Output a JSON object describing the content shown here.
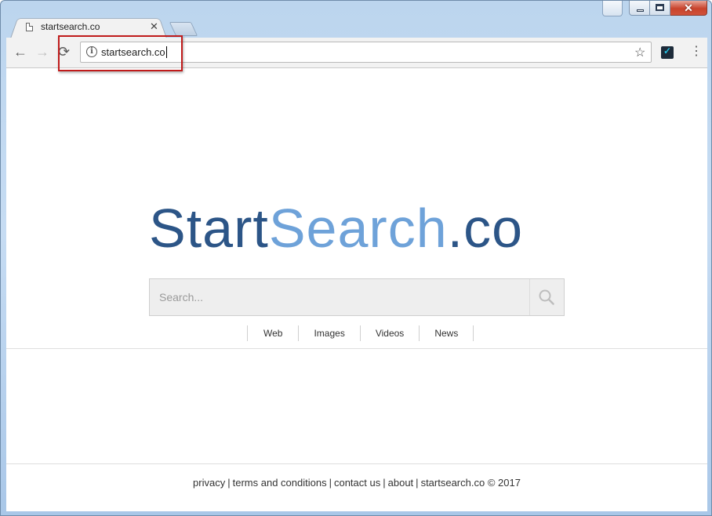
{
  "browser": {
    "tab_title": "startsearch.co",
    "tab_close_glyph": "✕",
    "address_url": "startsearch.co",
    "window_controls": {
      "close_glyph": "✕"
    },
    "icons": [
      "back-arrow-icon",
      "forward-arrow-icon",
      "reload-icon",
      "info-icon",
      "bookmark-star-icon",
      "extension-icon",
      "menu-icon"
    ],
    "nav": {
      "back": "←",
      "forward": "→",
      "reload": "⟳",
      "star": "☆",
      "menu": "⋮",
      "info": "i"
    }
  },
  "page": {
    "logo": {
      "part1": "Start",
      "part2": "Search",
      "part3": ".co"
    },
    "search": {
      "placeholder": "Search..."
    },
    "tabs": [
      "Web",
      "Images",
      "Videos",
      "News"
    ],
    "footer": {
      "links": [
        "privacy",
        "terms and conditions",
        "contact us",
        "about",
        "startsearch.co © 2017"
      ],
      "separator": "|"
    }
  },
  "colors": {
    "logo_dark": "#2c5587",
    "logo_light": "#6ea2d9",
    "highlight_box": "#c01b1b"
  }
}
